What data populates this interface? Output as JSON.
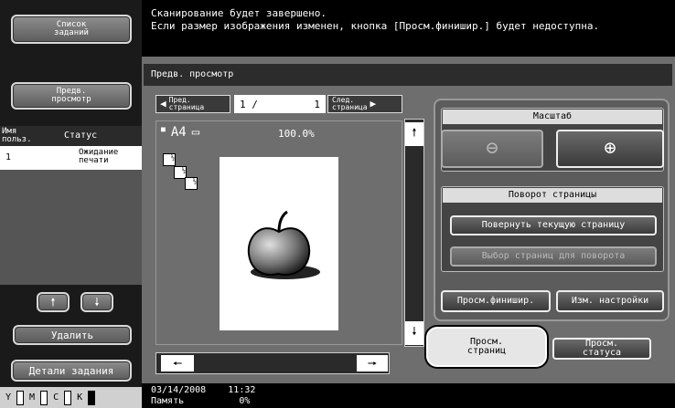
{
  "left": {
    "job_list_label": "Список\nзаданий",
    "preview_label": "Предв.\nпросмотр",
    "table_headers": {
      "user": "Имя\nпольз.",
      "status": "Статус"
    },
    "rows": [
      {
        "user": "1",
        "status": "Ожидание\nпечати"
      }
    ],
    "delete_label": "Удалить",
    "job_details_label": "Детали задания",
    "toner": [
      "Y",
      "M",
      "C",
      "K"
    ]
  },
  "message": {
    "line1": "Сканирование будет завершено.",
    "line2": "Если размер изображения изменен, кнопка [Просм.финишир.] будет недоступна."
  },
  "panel_title": "Предв. просмотр",
  "nav": {
    "prev_label": "Пред.\nстраница",
    "next_label": "След.\nстраница",
    "page_current": "1 /",
    "page_total": "1"
  },
  "preview": {
    "paper": "A4",
    "zoom": "100.0%"
  },
  "scale": {
    "title": "Масштаб"
  },
  "rotate": {
    "title": "Поворот страницы",
    "rotate_current": "Повернуть текущую страницу",
    "select_pages": "Выбор страниц для поворота"
  },
  "buttons": {
    "finishing_view": "Просм.финишир.",
    "change_settings": "Изм. настройки",
    "view_pages": "Просм.\nстраниц",
    "view_status": "Просм.\nстатуса"
  },
  "footer": {
    "datetime": "03/14/2008    11:32",
    "memory": "Память          0%"
  },
  "colors": {
    "accent": "#2a2a2a",
    "selected_tab": "#e6e6e6"
  }
}
